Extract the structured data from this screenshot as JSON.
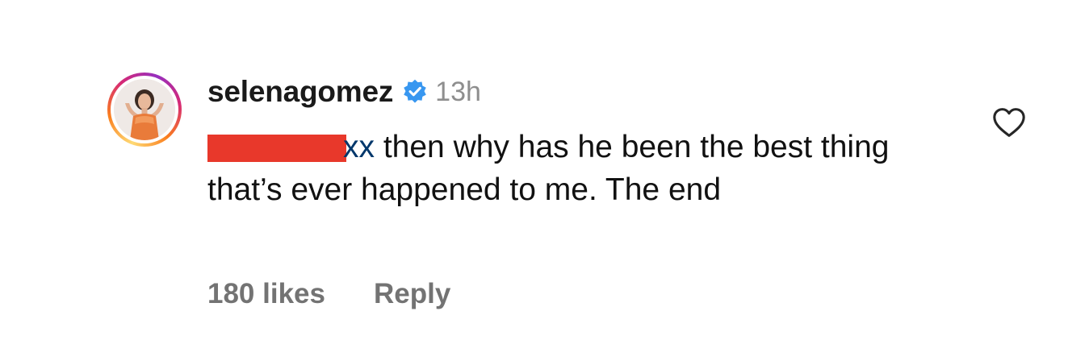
{
  "comment": {
    "author": {
      "username": "selenagomez",
      "verified_icon": "verified-badge-icon",
      "avatar_icon": "profile-avatar",
      "timestamp": "13h"
    },
    "mention": {
      "visible_suffix": "xx",
      "redacted": true,
      "redaction_color": "#e8382b",
      "mention_color": "#00376b"
    },
    "text": " then why has he been the best thing that’s ever happened to me. The end",
    "likes_label": "180 likes",
    "reply_label": "Reply",
    "like_icon": "heart-outline-icon"
  },
  "colors": {
    "verified_blue": "#3897f0",
    "muted_text": "#8e8e8e",
    "action_text": "#737373"
  }
}
